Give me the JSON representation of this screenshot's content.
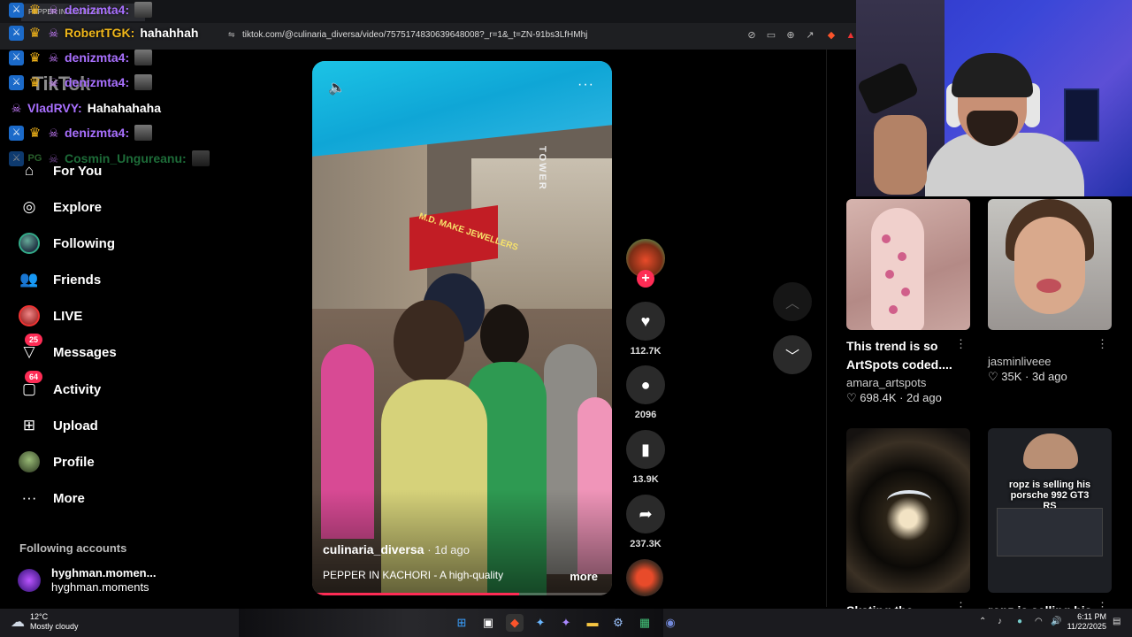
{
  "browser": {
    "tab_title": "PEPPER IN KACHORI - A",
    "url": "tiktok.com/@culinaria_diversa/video/7575174830639648008?_r=1&_t=ZN-91bs3LfHMhj"
  },
  "chat": [
    {
      "user": "denizmta4:",
      "color": "#a970ff",
      "message": "",
      "emote": true,
      "badges": [
        "mod",
        "crown",
        "bot"
      ]
    },
    {
      "user": "RobertTGK:",
      "color": "#f0b71a",
      "message": "hahahhah",
      "emote": false,
      "badges": [
        "mod",
        "crown",
        "bot"
      ]
    },
    {
      "user": "denizmta4:",
      "color": "#a970ff",
      "message": "",
      "emote": true,
      "badges": [
        "mod",
        "crown",
        "bot"
      ]
    },
    {
      "user": "denizmta4:",
      "color": "#a970ff",
      "message": "",
      "emote": true,
      "badges": [
        "mod",
        "crown",
        "bot"
      ]
    },
    {
      "user": "VladRVY:",
      "color": "#a970ff",
      "message": "Hahahahaha",
      "emote": false,
      "badges": [
        "bot"
      ]
    },
    {
      "user": "denizmta4:",
      "color": "#a970ff",
      "message": "",
      "emote": true,
      "badges": [
        "mod",
        "crown",
        "bot"
      ]
    },
    {
      "user": "Cosmin_Ungureanu:",
      "color": "#35c467",
      "message": "",
      "emote": true,
      "badges": [
        "mod",
        "pg",
        "bot"
      ]
    }
  ],
  "tiktok": {
    "logo": "TikTok",
    "nav": [
      {
        "key": "for-you",
        "label": "For You",
        "icon": "home-icon"
      },
      {
        "key": "explore",
        "label": "Explore",
        "icon": "compass-icon"
      },
      {
        "key": "following",
        "label": "Following",
        "icon": "avatar"
      },
      {
        "key": "friends",
        "label": "Friends",
        "icon": "friends-icon"
      },
      {
        "key": "live",
        "label": "LIVE",
        "icon": "avatar-live"
      },
      {
        "key": "messages",
        "label": "Messages",
        "icon": "send-icon",
        "badge": "25"
      },
      {
        "key": "activity",
        "label": "Activity",
        "icon": "chat-icon",
        "badge": "64"
      },
      {
        "key": "upload",
        "label": "Upload",
        "icon": "plus-square-icon"
      },
      {
        "key": "profile",
        "label": "Profile",
        "icon": "avatar-profile"
      },
      {
        "key": "more",
        "label": "More",
        "icon": "ellipsis-icon"
      }
    ],
    "following_title": "Following accounts",
    "following_account": {
      "name": "hyghman.momen...",
      "handle": "hyghman.moments"
    }
  },
  "video": {
    "author": "culinaria_diversa",
    "age": "· 1d ago",
    "caption": "PEPPER IN KACHORI   -  A high-quality",
    "more": "more",
    "progress": 0.69,
    "sign_text": "TOWER",
    "shop_text": "M.D. MAKE JEWELLERS"
  },
  "actions": {
    "likes": "112.7K",
    "comments": "2096",
    "saves": "13.9K",
    "shares": "237.3K"
  },
  "recommendations": [
    {
      "title": "This trend is so ArtSpots coded....",
      "user": "amara_artspots",
      "likes": "698.4K",
      "age": "2d ago",
      "thumb": "hand"
    },
    {
      "title": "",
      "user": "jasminliveee",
      "likes": "35K",
      "age": "3d ago",
      "thumb": "face"
    },
    {
      "title": "Skating the...",
      "user": "",
      "likes": "",
      "age": "",
      "thumb": "tunnel"
    },
    {
      "title": "ropz is selling his...",
      "user": "",
      "likes": "",
      "age": "",
      "thumb": "screen",
      "overlay": "ropz is selling his porsche 992 GT3 RS"
    }
  ],
  "taskbar": {
    "temp": "12°C",
    "weather": "Mostly cloudy",
    "time": "6:11 PM",
    "date": "11/22/2025",
    "weather_badge": "1"
  },
  "colors": {
    "accent": "#fe2c55",
    "background": "#000000",
    "sidebar_text": "#ffffff"
  }
}
